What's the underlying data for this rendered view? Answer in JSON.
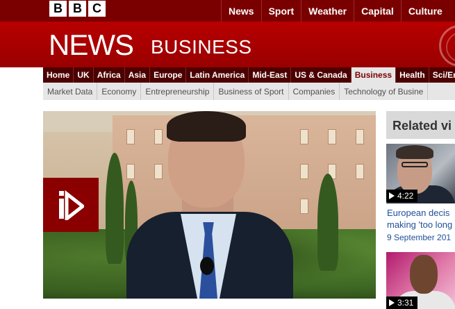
{
  "brand": {
    "logo_letters": [
      "B",
      "B",
      "C"
    ]
  },
  "top_nav": [
    "News",
    "Sport",
    "Weather",
    "Capital",
    "Culture"
  ],
  "banner": {
    "title": "NEWS",
    "section": "BUSINESS"
  },
  "section_nav": [
    {
      "label": "Home",
      "active": false
    },
    {
      "label": "UK",
      "active": false
    },
    {
      "label": "Africa",
      "active": false
    },
    {
      "label": "Asia",
      "active": false
    },
    {
      "label": "Europe",
      "active": false
    },
    {
      "label": "Latin America",
      "active": false
    },
    {
      "label": "Mid-East",
      "active": false
    },
    {
      "label": "US & Canada",
      "active": false
    },
    {
      "label": "Business",
      "active": true
    },
    {
      "label": "Health",
      "active": false
    },
    {
      "label": "Sci/En",
      "active": false
    }
  ],
  "sub_nav": [
    "Market Data",
    "Economy",
    "Entrepreneurship",
    "Business of Sport",
    "Companies",
    "Technology of Busine"
  ],
  "colors": {
    "brand_red": "#b80000",
    "dark_red": "#4d0000",
    "link_blue": "#1f4f99"
  },
  "video": {
    "play_icon": "play-icon"
  },
  "related": {
    "title": "Related vi",
    "items": [
      {
        "duration": "4:22",
        "headline_lines": [
          "European decis",
          "making 'too long"
        ],
        "date": "9 September 201"
      },
      {
        "duration": "3:31"
      }
    ]
  }
}
